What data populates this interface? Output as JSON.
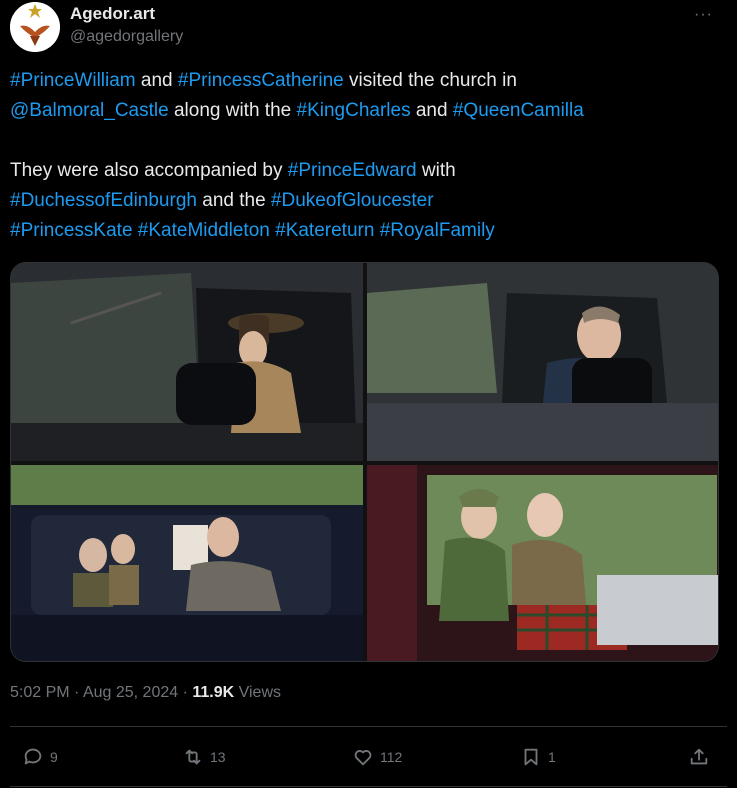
{
  "author": {
    "display_name": "Agedor.art",
    "handle": "@agedorgallery"
  },
  "more_label": "···",
  "tweet": {
    "line1": [
      {
        "text": "#PrinceWilliam",
        "tag": true
      },
      {
        "text": " and ",
        "tag": false
      },
      {
        "text": "#PrincessCatherine",
        "tag": true
      },
      {
        "text": " visited the church in",
        "tag": false
      }
    ],
    "line2": [
      {
        "text": "@Balmoral_Castle",
        "tag": true
      },
      {
        "text": " along with the ",
        "tag": false
      },
      {
        "text": "#KingCharles",
        "tag": true
      },
      {
        "text": " and ",
        "tag": false
      },
      {
        "text": "#QueenCamilla",
        "tag": true
      }
    ],
    "line3": [
      {
        "text": " They were also accompanied by ",
        "tag": false
      },
      {
        "text": "#PrinceEdward",
        "tag": true
      },
      {
        "text": " with",
        "tag": false
      }
    ],
    "line4": [
      {
        "text": "#DuchessofEdinburgh",
        "tag": true
      },
      {
        "text": " and the ",
        "tag": false
      },
      {
        "text": "#DukeofGloucester",
        "tag": true
      }
    ],
    "line5": [
      {
        "text": "#PrincessKate",
        "tag": true
      },
      {
        "text": " ",
        "tag": false
      },
      {
        "text": "#KateMiddleton",
        "tag": true
      },
      {
        "text": " ",
        "tag": false
      },
      {
        "text": "#Katereturn",
        "tag": true
      },
      {
        "text": " ",
        "tag": false
      },
      {
        "text": "#RoyalFamily",
        "tag": true
      }
    ]
  },
  "timestamp": {
    "time": "5:02 PM",
    "sep1": " · ",
    "date": "Aug 25, 2024",
    "sep2": " · ",
    "views_count": "11.9K",
    "views_label": " Views"
  },
  "actions": {
    "replies": "9",
    "reposts": "13",
    "likes": "112",
    "bookmarks": "1"
  },
  "colors": {
    "accent": "#1d9bf0",
    "muted": "#71767b",
    "text": "#e7e9ea",
    "background": "#000000"
  },
  "icons": [
    "reply-icon",
    "repost-icon",
    "like-icon",
    "bookmark-icon",
    "share-icon",
    "more-icon"
  ]
}
